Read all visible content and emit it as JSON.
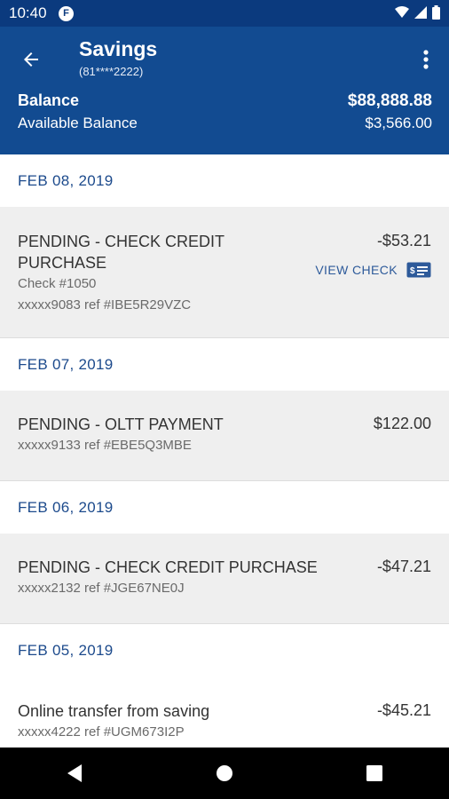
{
  "status_bar": {
    "time": "10:40",
    "notification_icon": "app-notification-icon",
    "icons": [
      "wifi-icon",
      "signal-icon",
      "battery-icon"
    ]
  },
  "header": {
    "title": "Savings",
    "account_number": "(81****2222)",
    "balance_label": "Balance",
    "balance_value": "$88,888.88",
    "available_label": "Available Balance",
    "available_value": "$3,566.00",
    "accent_color": "#124b91"
  },
  "transactions": {
    "groups": [
      {
        "date": "FEB 08, 2019",
        "items": [
          {
            "description_line1": "PENDING - CHECK CREDIT",
            "description_line2": "PURCHASE",
            "check_number": "Check #1050",
            "reference": "xxxxx9083 ref #IBE5R29VZC",
            "amount": "-$53.21",
            "view_check_label": "VIEW CHECK"
          }
        ]
      },
      {
        "date": "FEB 07, 2019",
        "items": [
          {
            "description": "PENDING - OLTT PAYMENT",
            "reference": "xxxxx9133 ref #EBE5Q3MBE",
            "amount": "$122.00"
          }
        ]
      },
      {
        "date": "FEB 06, 2019",
        "items": [
          {
            "description": "PENDING - CHECK CREDIT PURCHASE",
            "reference": "xxxxx2132 ref #JGE67NE0J",
            "amount": "-$47.21"
          }
        ]
      },
      {
        "date": "FEB 05, 2019",
        "items": [
          {
            "description": "Online transfer from saving",
            "reference": "xxxxx4222 ref #UGM673I2P",
            "amount": "-$45.21"
          }
        ]
      }
    ]
  },
  "nav_bar": {
    "buttons": [
      "back-triangle-icon",
      "home-circle-icon",
      "recents-square-icon"
    ]
  }
}
